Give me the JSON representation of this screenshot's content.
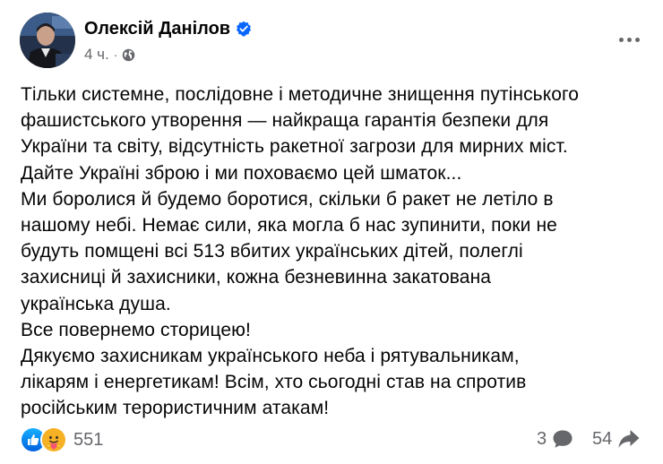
{
  "post": {
    "author_name": "Олексій Данілов",
    "timestamp": "4 ч.",
    "separator": "·",
    "lines": [
      "Тільки системне, послідовне і методичне знищення путінського",
      "фашистського утворення — найкраща гарантія безпеки для",
      "України та світу, відсутність ракетної загрози для мирних міст.",
      "Дайте Україні зброю і ми поховаємо цей шматок...",
      "Ми боролися й будемо боротися, скільки б ракет не летіло в",
      "нашому небі. Немає сили, яка могла б нас зупинити, поки не",
      "будуть помщені всі 513 вбитих українських дітей, полеглі",
      "захисниці й захисники, кожна безневинна закатована",
      "українська душа.",
      "Все повернемо сторицею!",
      "Дякуємо захисникам українського неба і рятувальникам,",
      "лікарям і енергетикам! Всім, хто сьогодні став на спротив",
      "російським терористичним атакам!"
    ]
  },
  "footer": {
    "reactions_count": "551",
    "comments_count": "3",
    "shares_count": "54"
  },
  "icons": {
    "verified": "verified-badge-icon",
    "privacy": "globe-icon",
    "more": "more-options-icon",
    "like": "like-reaction-icon",
    "care": "care-reaction-icon",
    "comment": "comment-bubble-icon",
    "share": "share-arrow-icon"
  },
  "colors": {
    "verified_blue": "#0866FF",
    "secondary_text": "#65676B",
    "text": "#050505",
    "care_yellow": "#F7B125"
  }
}
